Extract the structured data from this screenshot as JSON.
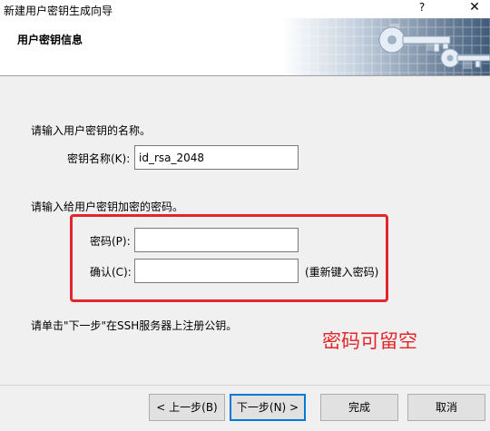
{
  "window": {
    "title": "新建用户密钥生成向导",
    "help": "?",
    "close": "✕"
  },
  "header": {
    "title": "用户密钥信息"
  },
  "form": {
    "name_prompt": "请输入用户密钥的名称。",
    "name_label": "密钥名称(K):",
    "name_value": "id_rsa_2048",
    "password_prompt": "请输入给用户密钥加密的密码。",
    "password_label": "密码(P):",
    "password_value": "",
    "confirm_label": "确认(C):",
    "confirm_value": "",
    "confirm_hint": "(重新键入密码)",
    "next_info": "请单击\"下一步\"在SSH服务器上注册公钥。"
  },
  "annotation": {
    "text": "密码可留空",
    "color": "#e3262c"
  },
  "buttons": {
    "back": "< 上一步(B)",
    "next": "下一步(N) >",
    "finish": "完成",
    "cancel": "取消"
  }
}
